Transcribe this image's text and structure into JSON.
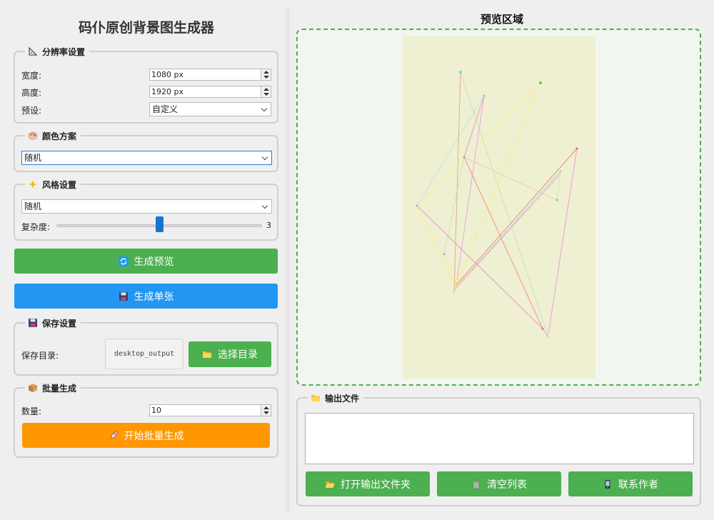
{
  "app": {
    "title": "码仆原创背景图生成器"
  },
  "resolution": {
    "title": "分辨率设置",
    "icon": "triangle-ruler-icon",
    "width_label": "宽度:",
    "width_value": "1080 px",
    "height_label": "高度:",
    "height_value": "1920 px",
    "preset_label": "预设:",
    "preset_value": "自定义"
  },
  "color": {
    "title": "颜色方案",
    "icon": "palette-icon",
    "value": "随机"
  },
  "style": {
    "title": "风格设置",
    "icon": "sparkles-icon",
    "value": "随机",
    "complexity_label": "复杂度:",
    "complexity_value": "3",
    "complexity_min": 1,
    "complexity_max": 5
  },
  "actions": {
    "preview_label": "生成预览",
    "preview_icon": "refresh-icon",
    "single_label": "生成单张",
    "single_icon": "floppy-disk-icon"
  },
  "save": {
    "title": "保存设置",
    "icon": "floppy-disk-icon",
    "dir_label": "保存目录:",
    "dir_value": "desktop_output",
    "choose_label": "选择目录",
    "choose_icon": "folder-icon"
  },
  "batch": {
    "title": "批量生成",
    "icon": "package-icon",
    "count_label": "数量:",
    "count_value": "10",
    "start_label": "开始批量生成",
    "start_icon": "rocket-icon"
  },
  "preview": {
    "title": "预览区域"
  },
  "output": {
    "title": "输出文件",
    "icon": "folder-icon",
    "open_label": "打开输出文件夹",
    "open_icon": "open-folder-icon",
    "clear_label": "清空列表",
    "clear_icon": "trash-icon",
    "contact_label": "联系作者",
    "contact_icon": "phone-icon"
  },
  "colors": {
    "green": "#4caf50",
    "blue": "#2196f3",
    "orange": "#ff9800",
    "slider": "#1a73d0",
    "canvas_bg": "#efefd2"
  }
}
